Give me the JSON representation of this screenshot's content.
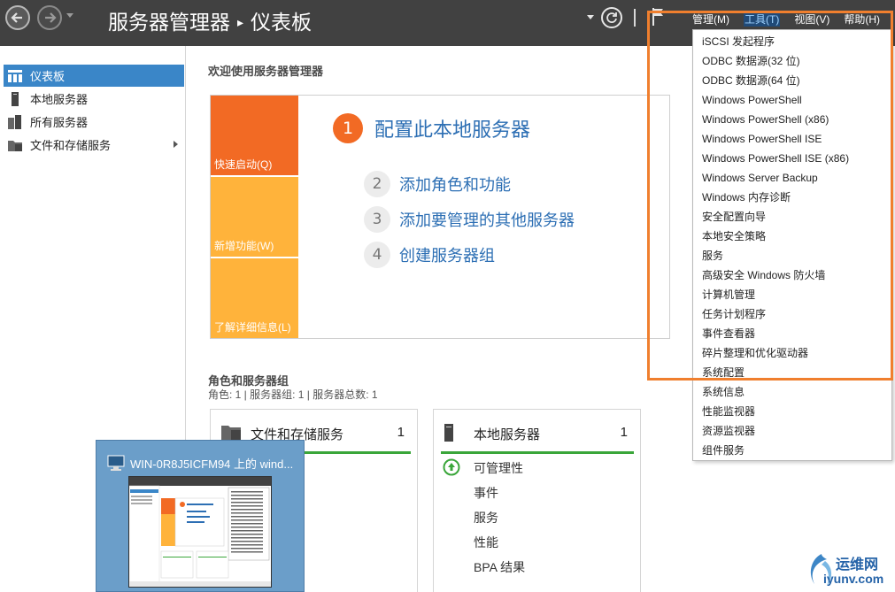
{
  "header": {
    "title_main": "服务器管理器",
    "title_separator": "▸",
    "title_sub": "仪表板",
    "menus": [
      {
        "label": "管理(M)"
      },
      {
        "label": "工具(T)"
      },
      {
        "label": "视图(V)"
      },
      {
        "label": "帮助(H)"
      }
    ]
  },
  "sidebar": {
    "items": [
      {
        "label": "仪表板",
        "icon": "dashboard-icon",
        "selected": true
      },
      {
        "label": "本地服务器",
        "icon": "server-icon"
      },
      {
        "label": "所有服务器",
        "icon": "servers-icon"
      },
      {
        "label": "文件和存储服务",
        "icon": "folder-icon",
        "has_children": true
      }
    ]
  },
  "main": {
    "welcome_title": "欢迎使用服务器管理器",
    "tiles": [
      {
        "label": "快速启动(Q)"
      },
      {
        "label": "新增功能(W)"
      },
      {
        "label": "了解详细信息(L)"
      }
    ],
    "steps": [
      {
        "num": "1",
        "label": "配置此本地服务器"
      },
      {
        "num": "2",
        "label": "添加角色和功能"
      },
      {
        "num": "3",
        "label": "添加要管理的其他服务器"
      },
      {
        "num": "4",
        "label": "创建服务器组"
      }
    ],
    "roles_title": "角色和服务器组",
    "roles_summary": "角色: 1 | 服务器组: 1 | 服务器总数: 1",
    "cards": [
      {
        "title": "文件和存储服务",
        "count": "1",
        "rows": []
      },
      {
        "title": "本地服务器",
        "count": "1",
        "rows": [
          "可管理性",
          "事件",
          "服务",
          "性能",
          "BPA 结果"
        ]
      }
    ]
  },
  "tools_menu": {
    "items": [
      "iSCSI 发起程序",
      "ODBC 数据源(32 位)",
      "ODBC 数据源(64 位)",
      "Windows PowerShell",
      "Windows PowerShell (x86)",
      "Windows PowerShell ISE",
      "Windows PowerShell ISE (x86)",
      "Windows Server Backup",
      "Windows 内存诊断",
      "安全配置向导",
      "本地安全策略",
      "服务",
      "高级安全 Windows 防火墙",
      "计算机管理",
      "任务计划程序",
      "事件查看器",
      "碎片整理和优化驱动器",
      "系统配置",
      "系统信息",
      "性能监视器",
      "资源监视器",
      "组件服务"
    ]
  },
  "taskbar_thumbnail": {
    "title": "WIN-0R8J5ICFM94 上的 wind..."
  },
  "watermark": {
    "name": "运维网",
    "url": "iyunv.com"
  },
  "colors": {
    "header_bg": "#414141",
    "accent_orange": "#f26a24",
    "tile_yellow": "#ffb33b",
    "link_blue": "#2d6fb4",
    "selected_blue": "#3a86c8",
    "highlight": "#f07f2e",
    "status_green": "#3aa63a"
  }
}
